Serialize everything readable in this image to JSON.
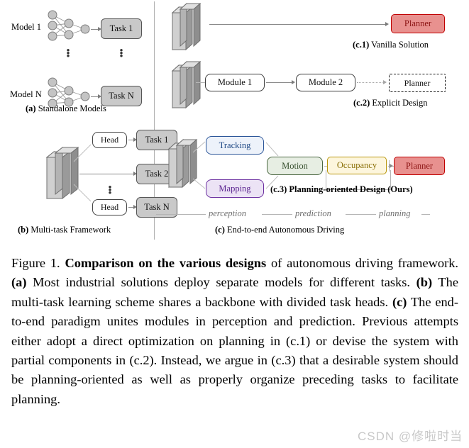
{
  "figure": {
    "panel_a": {
      "model_1_label": "Model 1",
      "model_n_label": "Model N",
      "task_1_label": "Task 1",
      "task_n_label": "Task N",
      "caption_tag": "(a)",
      "caption_text": "Standalone Models",
      "vertical_dots": "⋮"
    },
    "panel_b": {
      "head_top_label": "Head",
      "head_bottom_label": "Head",
      "task_1_label": "Task 1",
      "task_2_label": "Task 2",
      "task_n_label": "Task N",
      "caption_tag": "(b)",
      "caption_text": "Multi-task Framework",
      "vertical_dots": "⋮"
    },
    "panel_c1": {
      "planner_label": "Planner",
      "caption_tag": "(c.1)",
      "caption_text": "Vanilla Solution"
    },
    "panel_c2": {
      "module_1_label": "Module 1",
      "module_2_label": "Module 2",
      "planner_label": "Planner",
      "caption_tag": "(c.2)",
      "caption_text": "Explicit Design"
    },
    "panel_c3": {
      "tracking_label": "Tracking",
      "mapping_label": "Mapping",
      "motion_label": "Motion",
      "occupancy_label": "Occupancy",
      "planner_label": "Planner",
      "caption_tag": "(c.3)",
      "caption_text": "Planning-oriented Design (Ours)"
    },
    "panel_c": {
      "phase_perception": "perception",
      "phase_prediction": "prediction",
      "phase_planning": "planning",
      "caption_tag": "(c)",
      "caption_text": "End-to-end Autonomous Driving"
    },
    "colors": {
      "planner_border": "#c00000",
      "planner_fill": "#e8918f",
      "tracking_border": "#2c5699",
      "tracking_fill": "#edf2fa",
      "mapping_border": "#6b2fa0",
      "mapping_fill": "#ece3f5",
      "motion_border": "#4a6741",
      "motion_fill": "#e7eee3",
      "occupancy_border": "#b8960c",
      "occupancy_fill": "#fdf6dd",
      "task_fill": "#c9c9c9",
      "task_border": "#555555"
    }
  },
  "caption": {
    "figure_number": "Figure 1.",
    "bold_title": "Comparison on the various designs",
    "body_1": " of autonomous driving framework. ",
    "tag_a": "(a)",
    "body_2": " Most industrial solutions deploy separate models for different tasks. ",
    "tag_b": "(b)",
    "body_3": " The multi-task learning scheme shares a backbone with divided task heads. ",
    "tag_c": "(c)",
    "body_4": " The end-to-end paradigm unites modules in perception and prediction. Previous attempts either adopt a direct optimization on planning in (c.1) or devise the system with partial components in (c.2). Instead, we argue in (c.3) that a desirable system should be planning-oriented as well as properly organize preceding tasks to facilitate planning."
  },
  "watermark": {
    "text": "CSDN @修啦时当"
  }
}
